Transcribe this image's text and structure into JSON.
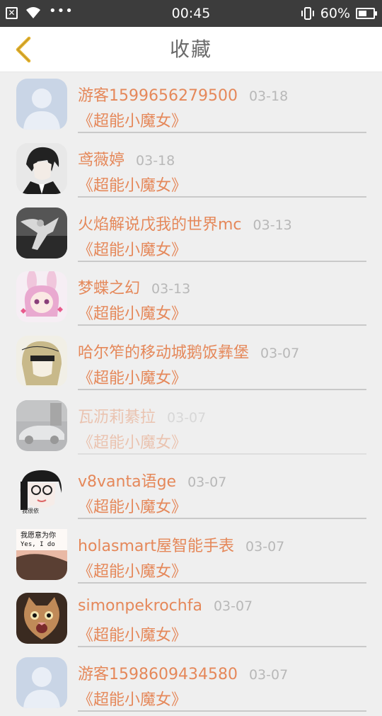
{
  "status_bar": {
    "time": "00:45",
    "battery": "60%",
    "battery_level": 0.6,
    "dots": "•••",
    "icons": [
      "notification-close-icon",
      "wifi-icon",
      "more-dots-icon",
      "vibrate-icon",
      "battery-icon"
    ]
  },
  "nav": {
    "title": "收藏",
    "back_icon": "chevron-left-icon",
    "accent_color": "#e5b32e"
  },
  "colors": {
    "name": "#e5885a",
    "date": "#b8b8b8",
    "divider": "#c9c9c9",
    "background": "#efefef"
  },
  "items": [
    {
      "name": "游客1599656279500",
      "date": "03-18",
      "book": "《超能小魔女》",
      "avatar": "default-avatar"
    },
    {
      "name": "鸢薇婷",
      "date": "03-18",
      "book": "《超能小魔女》",
      "avatar": "anime-boy-avatar"
    },
    {
      "name": "火焰解说戊我的世界mc",
      "date": "03-13",
      "book": "《超能小魔女》",
      "avatar": "dancer-bw-avatar"
    },
    {
      "name": "梦蝶之幻",
      "date": "03-13",
      "book": "《超能小魔女》",
      "avatar": "bunny-girl-avatar"
    },
    {
      "name": "哈尔笮的移动城鹅饭彝堡",
      "date": "03-07",
      "book": "《超能小魔女》",
      "avatar": "sketch-girl-avatar"
    },
    {
      "name": "瓦沥莉綦拉",
      "date": "03-07",
      "book": "《超能小魔女》",
      "avatar": "sports-car-avatar"
    },
    {
      "name": "v8vanta语ge",
      "date": "03-07",
      "book": "《超能小魔女》",
      "avatar": "glasses-girl-avatar"
    },
    {
      "name": "holasmart屋智能手表",
      "date": "03-07",
      "book": "《超能小魔女》",
      "avatar": "text-photo-avatar"
    },
    {
      "name": "simonpekrochfa",
      "date": "03-07",
      "book": "《超能小魔女》",
      "avatar": "cat-avatar"
    },
    {
      "name": "游客1598609434580",
      "date": "03-07",
      "book": "《超能小魔女》",
      "avatar": "default-avatar"
    }
  ],
  "avatar_texts": {
    "glasses_caption": "我很依",
    "text_photo_line1": "我愿意为你",
    "text_photo_line2": "Yes, I do"
  }
}
